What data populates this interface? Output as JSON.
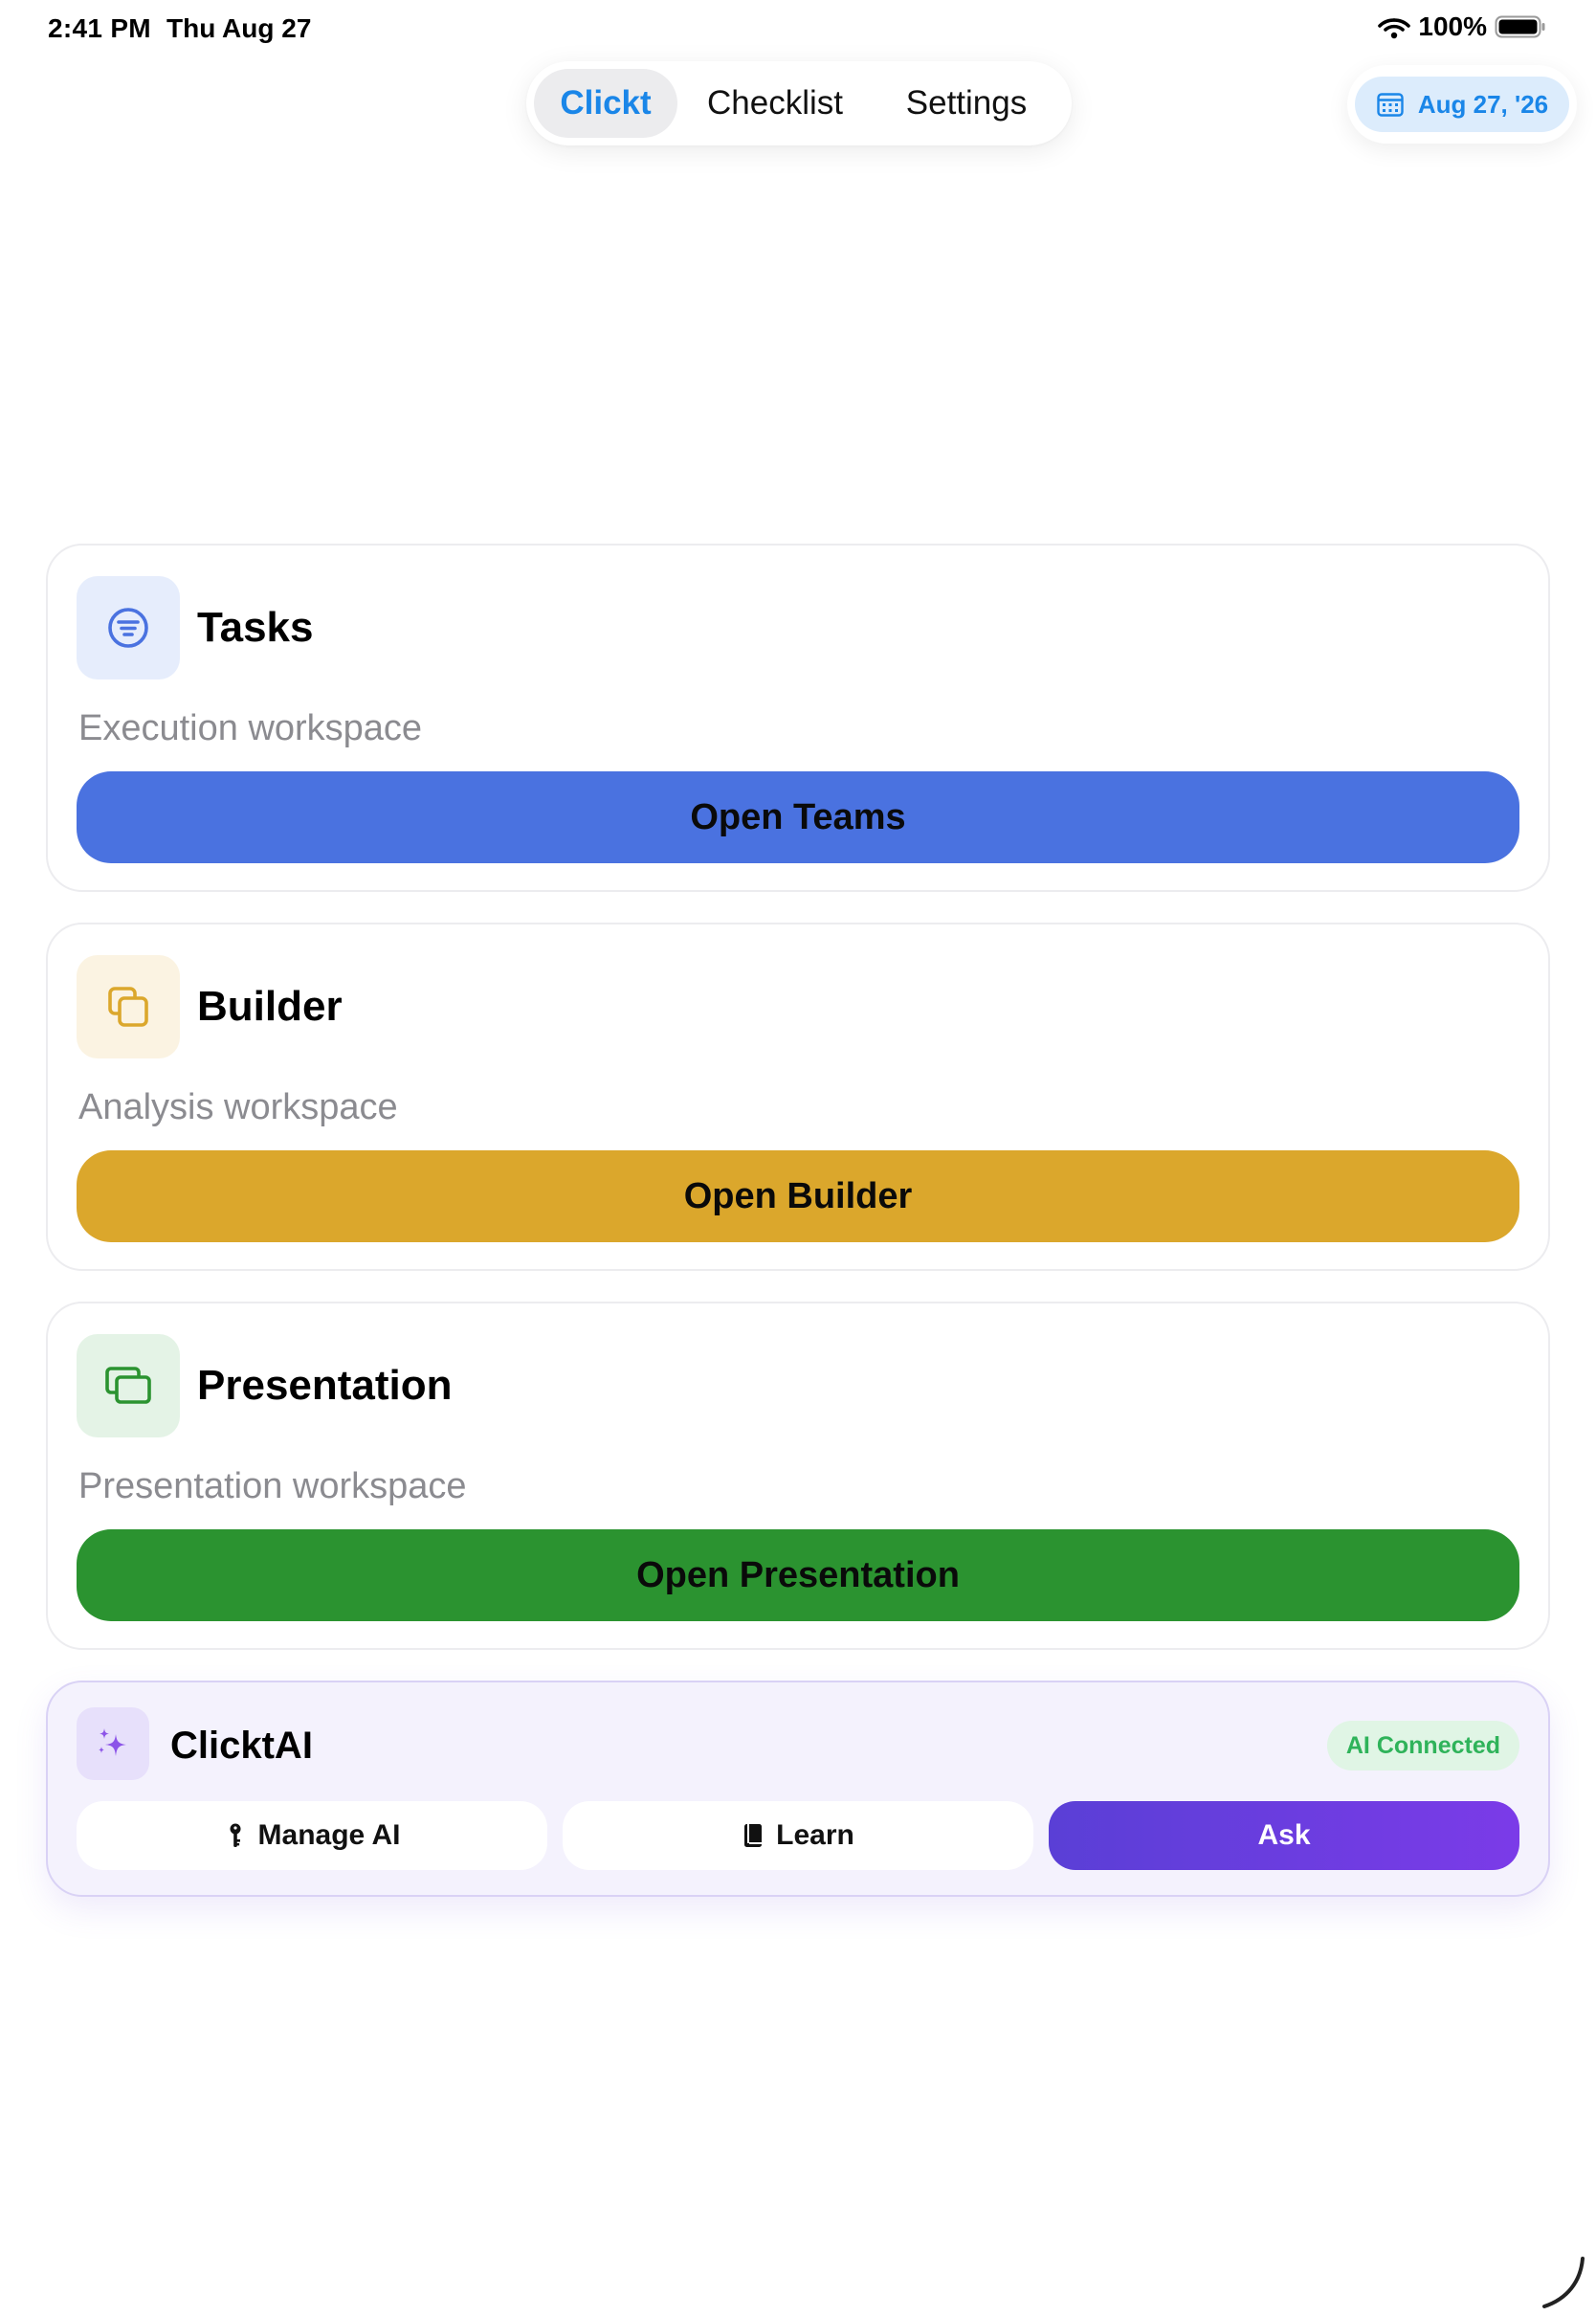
{
  "status_bar": {
    "time": "2:41 PM",
    "date": "Thu Aug 27",
    "battery": "100%"
  },
  "nav": {
    "tabs": [
      {
        "label": "Clickt",
        "active": true
      },
      {
        "label": "Checklist",
        "active": false
      },
      {
        "label": "Settings",
        "active": false
      }
    ]
  },
  "date_pill": {
    "label": "Aug 27, '26",
    "icon": "calendar-icon"
  },
  "colors": {
    "accent_blue": "#1a86e8",
    "tasks": "#4a72e0",
    "builder": "#dba72c",
    "presentation": "#2b9330",
    "ai_gradient_start": "#5a3fd6",
    "ai_gradient_end": "#7b3be8",
    "ai_connected": "#2fb35a"
  },
  "cards": [
    {
      "title": "Tasks",
      "subtitle": "Execution workspace",
      "button": "Open Teams",
      "icon": "filter-list-icon",
      "color": "#4a72e0",
      "icon_bg": "#e6edfc"
    },
    {
      "title": "Builder",
      "subtitle": "Analysis workspace",
      "button": "Open Builder",
      "icon": "stacked-squares-icon",
      "color": "#dba72c",
      "icon_bg": "#fbf3e2"
    },
    {
      "title": "Presentation",
      "subtitle": "Presentation workspace",
      "button": "Open Presentation",
      "icon": "stacked-windows-icon",
      "color": "#2b9330",
      "icon_bg": "#e4f3e6"
    }
  ],
  "ai": {
    "title": "ClicktAI",
    "badge": "AI Connected",
    "icon": "sparkles-icon",
    "buttons": {
      "manage": {
        "label": "Manage AI",
        "icon": "key-icon"
      },
      "learn": {
        "label": "Learn",
        "icon": "book-icon"
      },
      "ask": {
        "label": "Ask"
      }
    }
  }
}
